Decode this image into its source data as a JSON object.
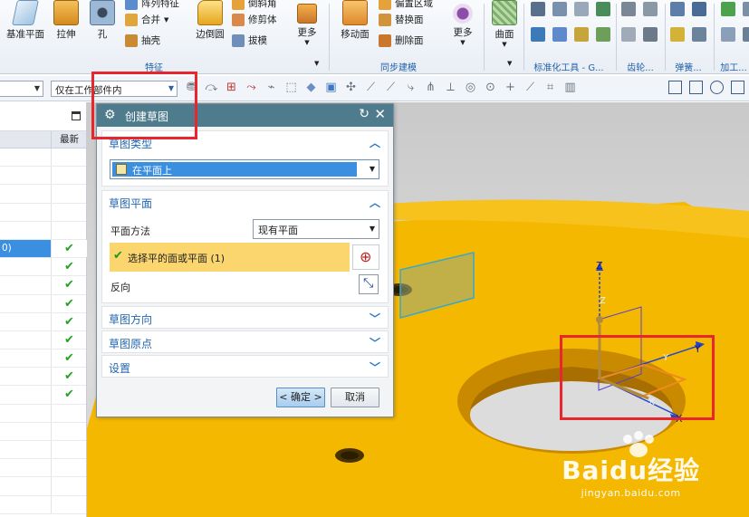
{
  "ribbon": {
    "buttons": [
      {
        "label": "基准平面",
        "icon": "datum-plane-icon"
      },
      {
        "label": "拉伸",
        "icon": "extrude-icon"
      },
      {
        "label": "孔",
        "icon": "hole-icon"
      },
      {
        "label": "边倒圆",
        "icon": "edge-blend-icon"
      },
      {
        "label": "更多",
        "icon": "more-icon"
      },
      {
        "label": "移动面",
        "icon": "move-face-icon"
      },
      {
        "label": "更多",
        "icon": "more-icon"
      },
      {
        "label": "曲面",
        "icon": "surface-icon"
      }
    ],
    "small_buttons": [
      {
        "label": "阵列特征",
        "icon": "pattern-feature-icon"
      },
      {
        "label": "合并",
        "icon": "unite-icon"
      },
      {
        "label": "抽壳",
        "icon": "shell-icon"
      },
      {
        "label": "倒斜角",
        "icon": "chamfer-icon"
      },
      {
        "label": "修剪体",
        "icon": "trim-body-icon"
      },
      {
        "label": "拔模",
        "icon": "draft-icon"
      },
      {
        "label": "偏置区域",
        "icon": "offset-region-icon"
      },
      {
        "label": "替换面",
        "icon": "replace-face-icon"
      },
      {
        "label": "删除面",
        "icon": "delete-face-icon"
      }
    ],
    "groups": [
      {
        "label": "特征"
      },
      {
        "label": "同步建模"
      },
      {
        "label": "标准化工具 - G..."
      },
      {
        "label": "齿轮..."
      },
      {
        "label": "弹簧..."
      },
      {
        "label": "加工..."
      }
    ]
  },
  "toolbar": {
    "filter_value": "",
    "scope_value": "仅在工作部件内"
  },
  "navigator": {
    "column_latest": "最新",
    "rows": [
      {
        "label": "",
        "latest": ""
      },
      {
        "label": "",
        "latest": ""
      },
      {
        "label": "",
        "latest": ""
      },
      {
        "label": "",
        "latest": ""
      },
      {
        "label": "",
        "latest": ""
      },
      {
        "label": "0)",
        "latest": "✔"
      },
      {
        "label": "",
        "latest": "✔"
      },
      {
        "label": "",
        "latest": "✔"
      },
      {
        "label": "",
        "latest": "✔"
      },
      {
        "label": "",
        "latest": "✔"
      },
      {
        "label": "",
        "latest": "✔"
      },
      {
        "label": "",
        "latest": "✔"
      },
      {
        "label": "",
        "latest": "✔"
      },
      {
        "label": "",
        "latest": "✔"
      },
      {
        "label": "",
        "latest": ""
      },
      {
        "label": "",
        "latest": ""
      },
      {
        "label": "",
        "latest": ""
      },
      {
        "label": "",
        "latest": ""
      },
      {
        "label": "",
        "latest": ""
      },
      {
        "label": "",
        "latest": ""
      }
    ]
  },
  "dialog": {
    "title": "创建草图",
    "sections": {
      "type": {
        "header": "草图类型",
        "value": "在平面上"
      },
      "plane": {
        "header": "草图平面",
        "method_label": "平面方法",
        "method_value": "现有平面",
        "select_label": "选择平的面或平面 (1)",
        "reverse_label": "反向"
      },
      "orientation": {
        "header": "草图方向"
      },
      "origin": {
        "header": "草图原点"
      },
      "settings": {
        "header": "设置"
      }
    },
    "ok_label": "< 确定 >",
    "cancel_label": "取消"
  },
  "viewport": {
    "axes": {
      "z": "Z",
      "y": "Y",
      "x": "X"
    },
    "watermark": {
      "brand": "Baidu经验",
      "url": "jingyan.baidu.com"
    }
  },
  "colors": {
    "part_face": "#f5b800",
    "part_side": "#c98a00",
    "dialog_title": "#4f7c8d",
    "selection_row": "#fbd56d",
    "highlight": "#e8262d"
  }
}
